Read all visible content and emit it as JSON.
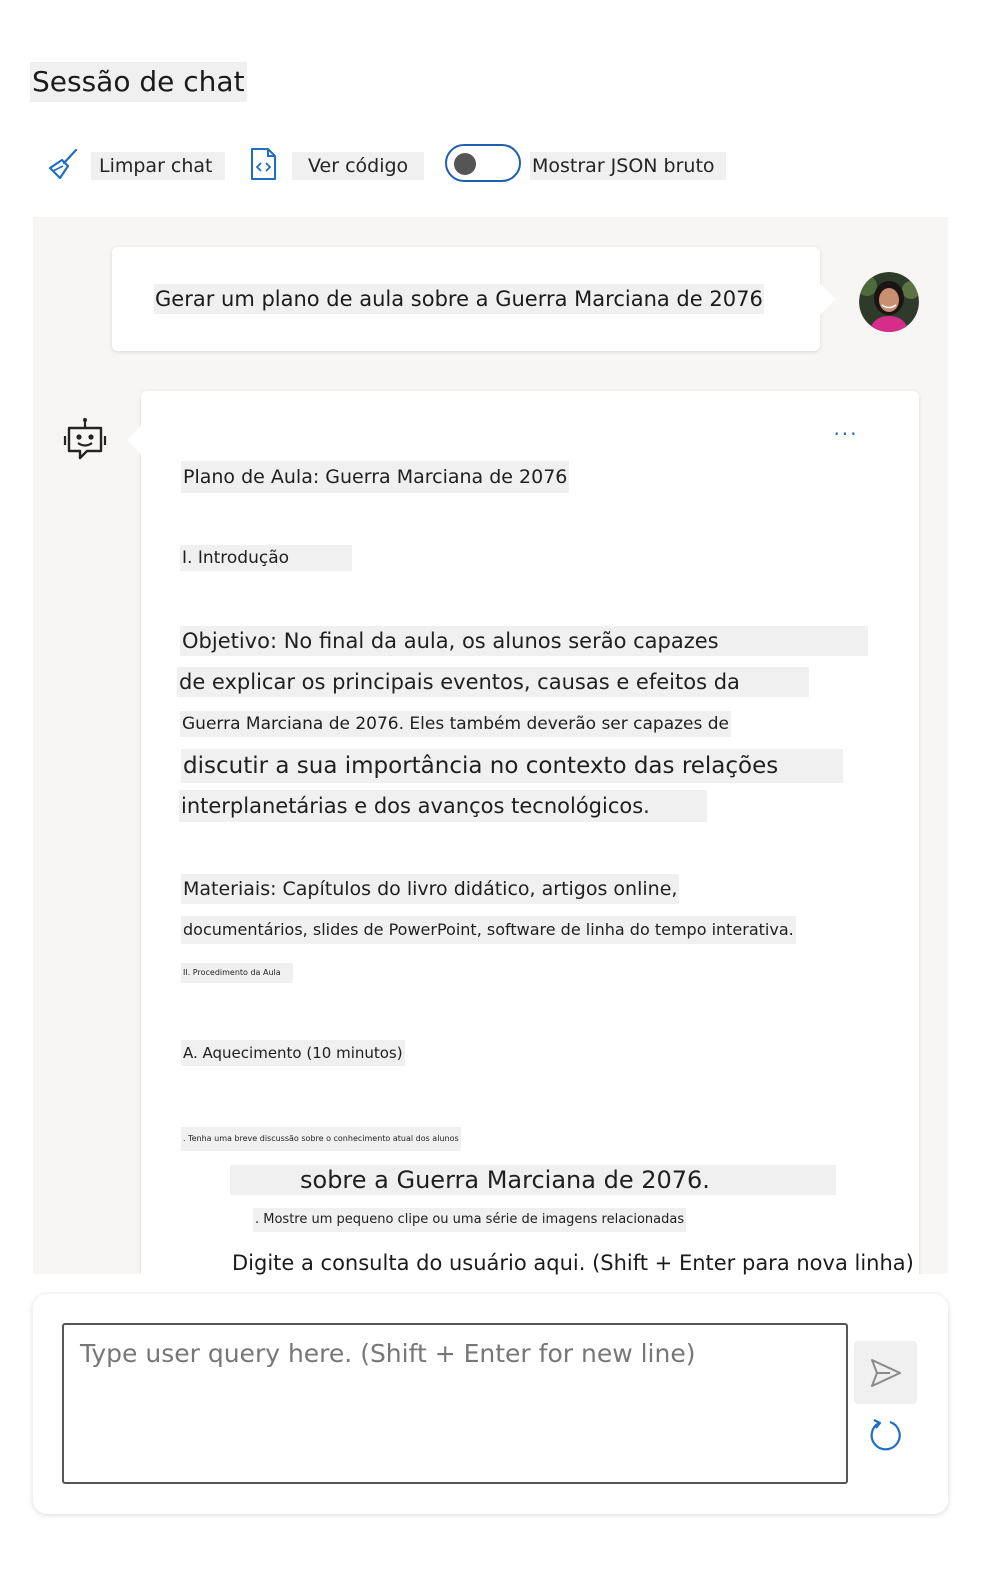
{
  "page": {
    "title": "Sessão de chat"
  },
  "toolbar": {
    "clear_label": "Limpar chat",
    "code_label": "Ver código",
    "json_label": "Mostrar JSON bruto",
    "json_toggle_on": false
  },
  "messages": {
    "user": {
      "text": "Gerar um plano de aula sobre a Guerra Marciana de 2076"
    },
    "assistant": {
      "more_label": "...",
      "lines": [
        "Plano de Aula: Guerra Marciana de 2076",
        "I. Introdução",
        "Objetivo: No final da aula, os alunos serão capazes",
        "de explicar os principais eventos, causas e efeitos da",
        "Guerra Marciana de 2076. Eles também deverão ser capazes de",
        "discutir a sua importância no contexto das relações",
        "interplanetárias e dos avanços tecnológicos.",
        "Materiais: Capítulos do livro didático, artigos online,",
        "documentários, slides de PowerPoint, software de linha do tempo interativa.",
        "II. Procedimento da Aula",
        "A. Aquecimento (10 minutos)",
        ". Tenha uma breve discussão sobre o conhecimento atual dos alunos",
        "sobre a Guerra Marciana de 2076.",
        ". Mostre um pequeno clipe ou uma série de imagens relacionadas"
      ]
    }
  },
  "overlay_caption": "Digite a consulta do usuário aqui. (Shift + Enter para nova linha)",
  "input": {
    "placeholder": "Type user query here. (Shift + Enter for new line)",
    "value": ""
  },
  "icons": {
    "clear": "broom-icon",
    "code": "code-file-icon",
    "bot": "bot-icon",
    "send": "send-icon",
    "refresh": "refresh-icon"
  },
  "colors": {
    "accent": "#1f6fc5",
    "chat_background": "#f7f6f5"
  }
}
